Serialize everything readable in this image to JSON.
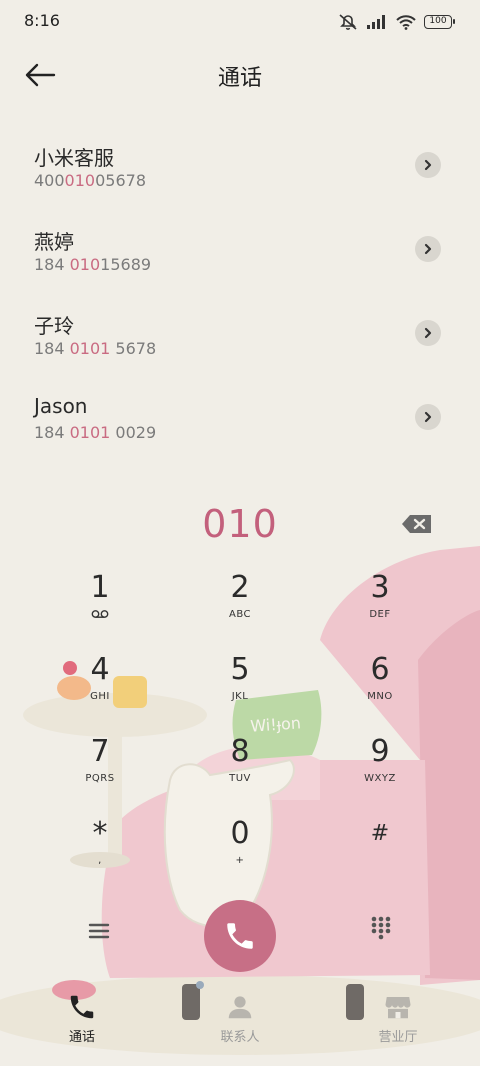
{
  "status_bar": {
    "time": "8:16",
    "battery": "100"
  },
  "header": {
    "title": "通话"
  },
  "contacts": [
    {
      "name": "小米客服",
      "num_pre": "400",
      "num_match": "010",
      "num_post": "05678"
    },
    {
      "name": "燕婷",
      "num_pre": "184 ",
      "num_match": "010",
      "num_post": "15689"
    },
    {
      "name": "子玲",
      "num_pre": "184 ",
      "num_match": "0101",
      "num_post": " 5678"
    },
    {
      "name": "Jason",
      "num_pre": "184 ",
      "num_match": "0101",
      "num_post": " 0029"
    }
  ],
  "dialer": {
    "input": "010"
  },
  "keypad": {
    "keys": [
      {
        "digit": "1",
        "letters": ""
      },
      {
        "digit": "2",
        "letters": "ABC"
      },
      {
        "digit": "3",
        "letters": "DEF"
      },
      {
        "digit": "4",
        "letters": "GHI"
      },
      {
        "digit": "5",
        "letters": "JKL"
      },
      {
        "digit": "6",
        "letters": "MNO"
      },
      {
        "digit": "7",
        "letters": "PQRS"
      },
      {
        "digit": "8",
        "letters": "TUV"
      },
      {
        "digit": "9",
        "letters": "WXYZ"
      },
      {
        "digit": "*",
        "letters": ","
      },
      {
        "digit": "0",
        "letters": "+"
      },
      {
        "digit": "#",
        "letters": ""
      }
    ]
  },
  "nav": {
    "items": [
      {
        "label": "通话",
        "active": true
      },
      {
        "label": "联系人",
        "active": false
      },
      {
        "label": "营业厅",
        "active": false
      }
    ]
  },
  "illustration": {
    "sign_text": "Wi!ɟon"
  },
  "colors": {
    "accent": "#c3607c",
    "call_button": "#c76f86",
    "background": "#f1eee7",
    "sofa": "#f0c9cf"
  }
}
